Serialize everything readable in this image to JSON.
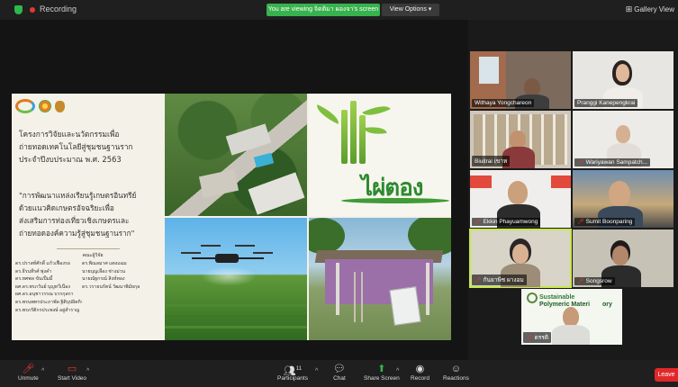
{
  "topbar": {
    "recording_label": "Recording",
    "viewing_banner": "You are viewing จิตติมา ผองจา's screen",
    "view_options": "View Options",
    "gallery_view": "Gallery View"
  },
  "slide": {
    "title": "โครงการวิจัยและนวัตกรรมเพื่อ\nถ่ายทอดเทคโนโลยีสู่ชุมชนฐานราก\nประจำปีงบประมาณ พ.ศ. 2563",
    "subtitle": "\"การพัฒนาแหล่งเรียนรู้เกษตรอินทรีย์\nด้วยแนวคิดเกษตรอัจฉริยะเพื่อ\nส่งเสริมการท่องเที่ยวเชิงเกษตรและ\nถ่ายทอดองค์ความรู้สู่ชุมชนฐานราก\"",
    "team_heading": "คณะผู้วิจัย",
    "team": [
      [
        "ดร.ปราสท์ศักดิ์ แก้วเฟื่องรอ",
        "ดร.พิณลมาศ แตงแฉม"
      ],
      [
        "ดร.ธีรนทีรศ์ พุ่งคำ",
        "นายบุญเลื่อง ช่างม่วน"
      ],
      [
        "ดร.ทศพล ขันเปิ้มมี้",
        "นายณัฐกรณ์ สิงห์ทอง"
      ],
      [
        "ผศ.ดร.พรภวันย์ บุญทวีเนือง",
        "ดร.วราธนรัตน์ วัฒนาพิมัยกุล"
      ],
      [
        "ผศ.ดร.อนุชาวรรณ บวรกุลกา",
        ""
      ],
      [
        "ดร.พรนพทรประภาพัด ฐิติบุปผิตกิจ",
        ""
      ],
      [
        "ดร.พรภรัติกรประพงษ์ อยู่สำราญ",
        ""
      ]
    ],
    "bamboo_logo_text": "ไผ่ตอง"
  },
  "participants": [
    {
      "name": "Withaya Yongchareon",
      "muted": false
    },
    {
      "name": "Pranggi Kanepengkrai",
      "muted": false
    },
    {
      "name": "Biuitrai เขาห",
      "muted": false
    },
    {
      "name": "Wariyawan Sampatch...",
      "muted": true
    },
    {
      "name": "Ekkin Phayuamwong",
      "muted": true
    },
    {
      "name": "Sumit Boonparing",
      "muted": true
    },
    {
      "name": "กันยาพิช ผางอม",
      "muted": true
    },
    {
      "name": "Songsrow",
      "muted": true
    },
    {
      "name": "ดรรดิ",
      "muted": true
    }
  ],
  "tile9_banner": {
    "line1": "Sustainable",
    "line2": "Polymeric Materi",
    "line3": "ory"
  },
  "toolbar": {
    "unmute": "Unmute",
    "start_video": "Start Video",
    "participants": "Participants",
    "participants_count": "11",
    "chat": "Chat",
    "share_screen": "Share Screen",
    "record": "Record",
    "reactions": "Reactions",
    "leave": "Leave"
  }
}
